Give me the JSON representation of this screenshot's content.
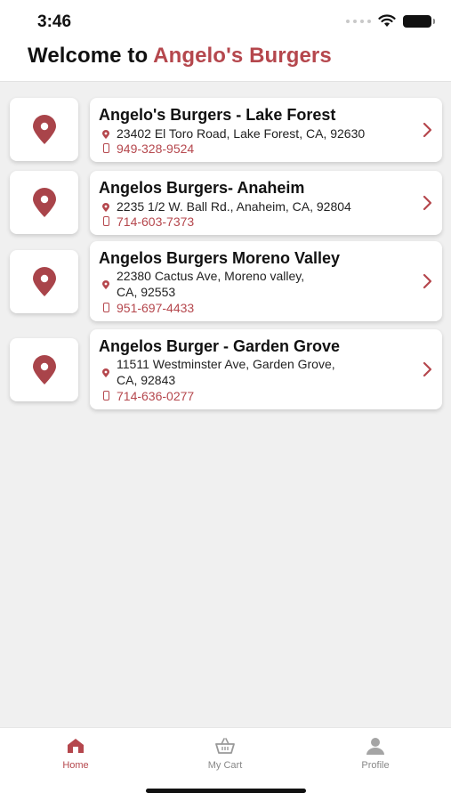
{
  "status_bar": {
    "time": "3:46"
  },
  "header": {
    "welcome": "Welcome to ",
    "brand": "Angelo's Burgers"
  },
  "colors": {
    "accent": "#b5474d",
    "background": "#f0f0f0",
    "card": "#ffffff"
  },
  "stores": [
    {
      "name": "Angelo's Burgers - Lake Forest",
      "address_line1": "23402 El Toro Road, Lake Forest, CA, 92630",
      "address_line2": "",
      "phone": "949-328-9524"
    },
    {
      "name": "Angelos Burgers- Anaheim",
      "address_line1": "2235 1/2 W. Ball Rd., Anaheim, CA, 92804",
      "address_line2": "",
      "phone": "714-603-7373"
    },
    {
      "name": "Angelos Burgers Moreno Valley",
      "address_line1": "22380 Cactus Ave, Moreno valley,",
      "address_line2": "CA, 92553",
      "phone": "951-697-4433"
    },
    {
      "name": "Angelos Burger - Garden Grove",
      "address_line1": "11511 Westminster Ave, Garden Grove,",
      "address_line2": "CA, 92843",
      "phone": "714-636-0277"
    }
  ],
  "tabs": [
    {
      "label": "Home",
      "icon": "home-icon",
      "active": true
    },
    {
      "label": "My Cart",
      "icon": "basket-icon",
      "active": false
    },
    {
      "label": "Profile",
      "icon": "person-icon",
      "active": false
    }
  ]
}
